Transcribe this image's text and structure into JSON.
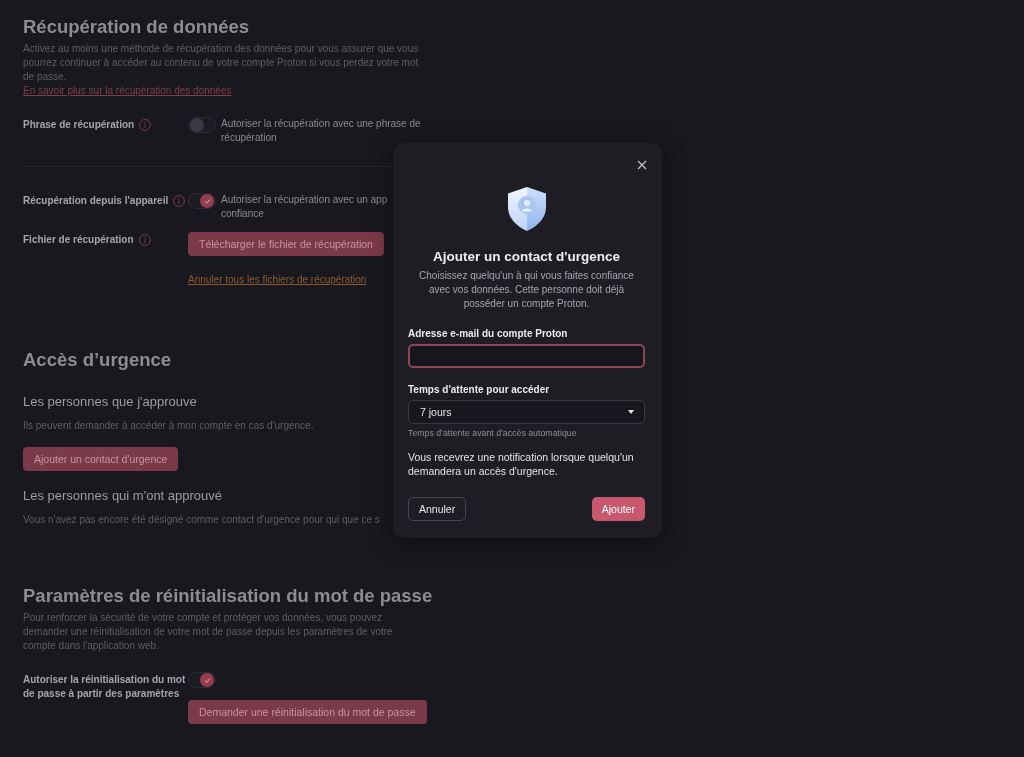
{
  "data_recovery": {
    "title": "Récupération de données",
    "description": "Activez au moins une méthode de récupération des données pour vous assurer que vous pourrez continuer à accéder au contenu de votre compte Proton si vous perdez votre mot de passe.",
    "link": "En savoir plus sur la récupération des données",
    "groups": [
      {
        "rows": [
          {
            "kind": "toggle",
            "label": "Phrase de récupération",
            "on": false,
            "text_lines": [
              "Autoriser la récupération avec une phrase de",
              "récupération"
            ]
          }
        ]
      },
      {
        "rows": [
          {
            "kind": "toggle",
            "label": "Récupération depuis l'appareil",
            "on": true,
            "text_lines": [
              "Autoriser la récupération avec un app",
              "confiance"
            ]
          },
          {
            "kind": "file",
            "label": "Fichier de récupération",
            "button": "Télécharger le fichier de récupération",
            "link": "Annuler tous les fichiers de récupération"
          }
        ]
      }
    ]
  },
  "emergency_access": {
    "title": "Accès d’urgence",
    "approved_by_me": {
      "title": "Les personnes que j'approuve",
      "description": "Ils peuvent demander à accéder à mon compte en cas d'urgence.",
      "button": "Ajouter un contact d'urgence"
    },
    "approved_me": {
      "title": "Les personnes qui m'ont approuvé",
      "description": "Vous n'avez pas encore été désigné comme contact d'urgence pour qui que ce s"
    }
  },
  "password_reset": {
    "title": "Paramètres de réinitialisation du mot de passe",
    "description": "Pour renforcer la sécurité de votre compte et protéger vos données, vous pouvez demander une réinitialisation de votre mot de passe depuis les paramètres de votre compte dans l'application web.",
    "toggle": {
      "label": "Autoriser la réinitialisation du mot de passe à partir des paramètres",
      "on": true
    },
    "button": "Demander une réinitialisation du mot de passe"
  },
  "dialog": {
    "title": "Ajouter un contact d'urgence",
    "description": "Choisissez quelqu'un à qui vous faites confiance avec vos données. Cette personne doit déjà posséder un compte Proton.",
    "email_field": {
      "label": "Adresse e-mail du compte Proton",
      "focused": true
    },
    "wait_field": {
      "label": "Temps d'attente pour accéder",
      "value": "7 jours",
      "hint": "Temps d'attente avant d'accès automatique"
    },
    "notice": "Vous recevrez une notification lorsque quelqu'un demandera un accès d'urgence.",
    "buttons": [
      {
        "label": "Annuler",
        "kind": "secondary"
      },
      {
        "label": "Ajouter",
        "kind": "primary"
      }
    ]
  }
}
